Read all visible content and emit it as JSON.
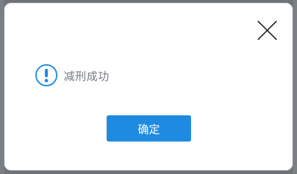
{
  "dialog": {
    "message": "减刑成功",
    "confirm_label": "确定",
    "icon": "exclamation-circle-icon",
    "close_icon": "close-icon"
  },
  "colors": {
    "accent": "#1e8be0",
    "message_text": "#777b80",
    "overlay": "#6f7378"
  }
}
